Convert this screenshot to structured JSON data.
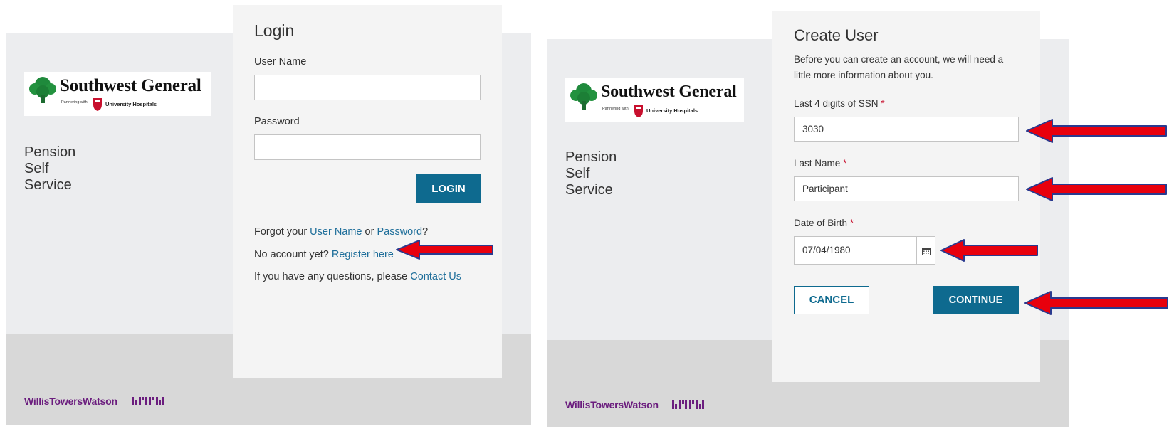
{
  "brand": {
    "name": "Southwest General",
    "partner_text": "Partnering with",
    "partner_name": "University Hospitals",
    "service_title": "Pension Self Service",
    "footer_company": "WillisTowersWatson"
  },
  "login": {
    "title": "Login",
    "username_label": "User Name",
    "username_value": "",
    "password_label": "Password",
    "password_value": "",
    "login_button": "LOGIN",
    "forgot_prefix": "Forgot your ",
    "forgot_username_link": "User Name",
    "forgot_or": " or ",
    "forgot_password_link": "Password",
    "forgot_suffix": "?",
    "no_account_prefix": "No account yet? ",
    "register_link": "Register here",
    "questions_prefix": "If you have any questions, please ",
    "contact_link": "Contact Us"
  },
  "create_user": {
    "title": "Create User",
    "intro_line1": "Before you can create an account, we will need a",
    "intro_line2": "little more information about you.",
    "ssn_label": "Last 4 digits of SSN",
    "ssn_value": "3030",
    "lastname_label": "Last Name",
    "lastname_value": "Participant",
    "dob_label": "Date of Birth",
    "dob_value": "07/04/1980",
    "required_mark": "*",
    "cancel_button": "CANCEL",
    "continue_button": "CONTINUE"
  },
  "colors": {
    "accent": "#0e6a8f",
    "link": "#1e6e9a",
    "arrow_fill": "#e8000d",
    "arrow_outline": "#2a3a8f",
    "footer_brand": "#6b1d7e"
  },
  "icons": [
    "tree-logo-icon",
    "uh-shield-icon",
    "wtw-mark-icon",
    "calendar-icon",
    "annotation-arrow-icon"
  ]
}
